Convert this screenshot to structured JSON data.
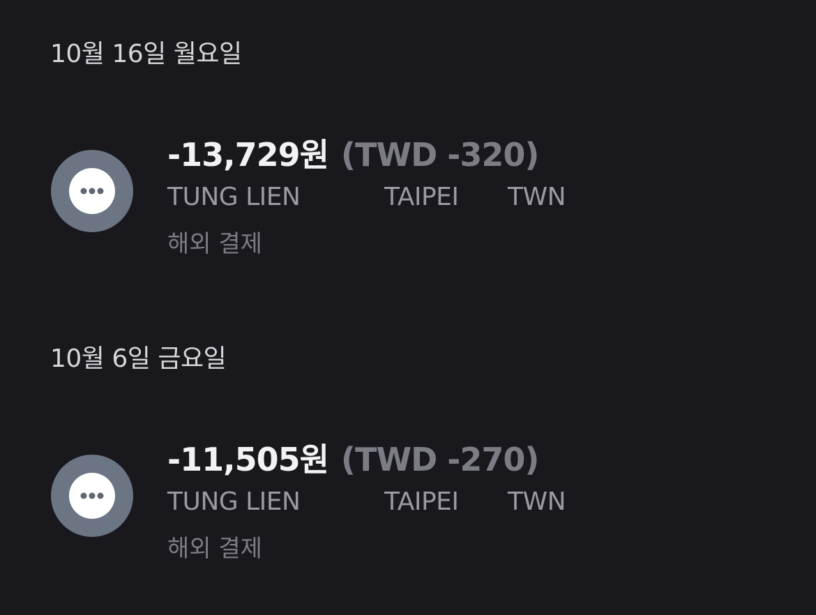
{
  "transactions_by_date": [
    {
      "date": "10월 16일 월요일",
      "items": [
        {
          "icon": "more-dots-icon",
          "amount_krw": "-13,729원",
          "amount_foreign": "(TWD -320)",
          "merchant": "TUNG LIEN",
          "city": "TAIPEI",
          "country": "TWN",
          "type": "해외 결제"
        }
      ]
    },
    {
      "date": "10월 6일 금요일",
      "items": [
        {
          "icon": "more-dots-icon",
          "amount_krw": "-11,505원",
          "amount_foreign": "(TWD -270)",
          "merchant": "TUNG LIEN",
          "city": "TAIPEI",
          "country": "TWN",
          "type": "해외 결제"
        }
      ]
    }
  ],
  "colors": {
    "background": "#18181d",
    "avatar_bg": "#6b7583",
    "amount_primary": "#f2f2f5",
    "amount_secondary": "#7c7c85",
    "merchant_text": "#9a9aa3",
    "date_text": "#d6d6db"
  }
}
